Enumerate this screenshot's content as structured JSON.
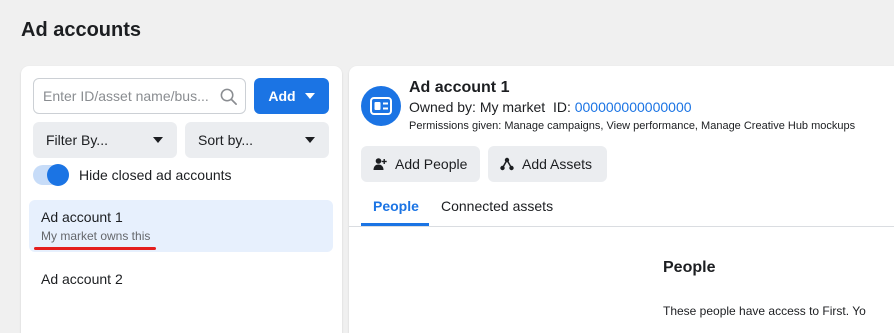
{
  "page": {
    "title": "Ad accounts"
  },
  "left": {
    "search": {
      "placeholder": "Enter ID/asset name/bus..."
    },
    "add_button": {
      "label": "Add"
    },
    "filter": {
      "label": "Filter By..."
    },
    "sort": {
      "label": "Sort by..."
    },
    "toggle": {
      "label": "Hide closed ad accounts",
      "on": true
    },
    "accounts": [
      {
        "name": "Ad account 1",
        "owner_text": "My market owns this",
        "selected": true
      },
      {
        "name": "Ad account 2",
        "owner_text": "",
        "selected": false
      }
    ]
  },
  "detail": {
    "title": "Ad account 1",
    "owned_by_label": "Owned by: My market",
    "id_label": "ID:",
    "id_value": "000000000000000",
    "permissions": "Permissions given: Manage campaigns, View performance, Manage Creative Hub mockups",
    "buttons": {
      "add_people": "Add People",
      "add_assets": "Add Assets"
    },
    "tabs": [
      {
        "label": "People",
        "active": true
      },
      {
        "label": "Connected assets",
        "active": false
      }
    ],
    "section": {
      "heading": "People",
      "description": "These people have access to First. Yo"
    }
  },
  "colors": {
    "accent": "#1b74e4",
    "selected_bg": "#e7f0fd",
    "highlight_underline": "#e41e1e"
  },
  "icons": {
    "search": "search-icon",
    "add_dropdown": "chevron-down-icon",
    "account": "ad-account-icon",
    "add_people": "add-person-icon",
    "add_assets": "share-nodes-icon"
  }
}
